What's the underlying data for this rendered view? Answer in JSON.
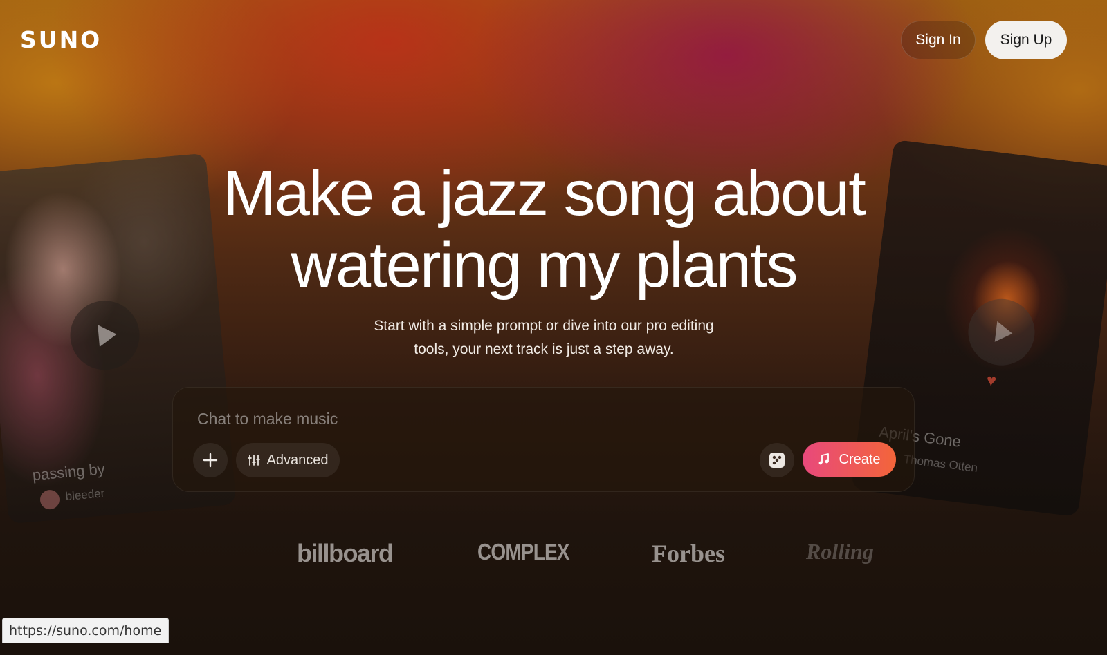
{
  "header": {
    "logo": "SUNO",
    "sign_in_label": "Sign In",
    "sign_up_label": "Sign Up"
  },
  "hero": {
    "title_line1": "Make a jazz song about",
    "title_line2": "watering my plants",
    "subtitle_line1": "Start with a simple prompt or dive into our pro editing",
    "subtitle_line2": "tools, your next track is just a step away."
  },
  "cards": [
    {
      "title": "passing by",
      "artist": "bleeder"
    },
    {
      "title": "April's Gone",
      "artist": "Thomas Otten"
    }
  ],
  "chat": {
    "placeholder": "Chat to make music",
    "value": "",
    "plus_icon": "plus-icon",
    "advanced_label": "Advanced",
    "advanced_icon": "sliders-icon",
    "dice_icon": "dice-icon",
    "create_label": "Create",
    "create_icon": "music-note-icon"
  },
  "press": [
    "billboard",
    "COMPLEX",
    "Forbes",
    "Rolling"
  ],
  "status_bar": {
    "url": "https://suno.com/home"
  },
  "colors": {
    "create_gradient_start": "#e8497c",
    "create_gradient_end": "#f3653a",
    "sign_up_bg": "#f3f1ee"
  }
}
